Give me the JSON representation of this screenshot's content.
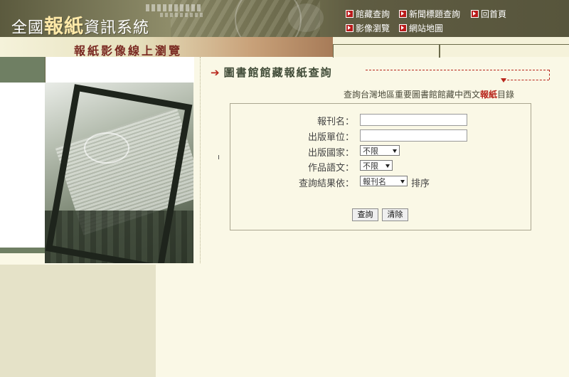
{
  "header": {
    "title_prefix": "全國",
    "title_big": "報紙",
    "title_suffix": "資訊系統",
    "nav": [
      {
        "label": "館藏查詢"
      },
      {
        "label": "新聞標題查詢"
      },
      {
        "label": "回首頁"
      },
      {
        "label": "影像瀏覽"
      },
      {
        "label": "網站地圖"
      }
    ],
    "subtitle": "報紙影像線上瀏覽"
  },
  "section": {
    "heading": "圖書館館藏報紙查詢",
    "description_prefix": "查詢台灣地區重要圖書館館藏中西文",
    "description_highlight": "報紙",
    "description_suffix": "目錄"
  },
  "form": {
    "newspaper_name_label": "報刊名：",
    "newspaper_name_value": "",
    "publisher_label": "出版單位：",
    "publisher_value": "",
    "country_label": "出版國家：",
    "country_selected": "不限",
    "language_label": "作品語文：",
    "language_selected": "不限",
    "sort_label": "查詢結果依：",
    "sort_selected": "報刊名",
    "sort_suffix": "排序",
    "search_button": "查詢",
    "clear_button": "清除"
  },
  "colors": {
    "accent_red": "#b8261c",
    "header_olive": "#6c6a4b",
    "background_cream": "#faf8e6"
  }
}
